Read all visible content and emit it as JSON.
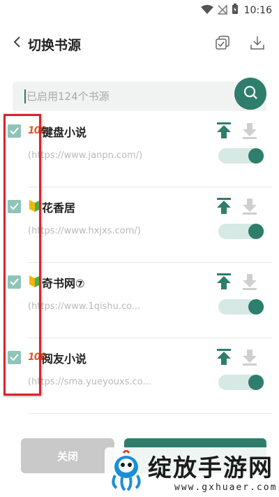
{
  "status_bar": {
    "time": "10:16"
  },
  "header": {
    "title": "切换书源",
    "back_icon": "chevron-left-icon",
    "select_all_icon": "copy-check-icon",
    "download_icon": "download-icon"
  },
  "search": {
    "placeholder": "已启用124个书源",
    "icon": "search-icon"
  },
  "sources": [
    {
      "name": "键盘小说",
      "badge": "100",
      "url": "(https://www.janpn.com/)",
      "checked": true,
      "enabled": true
    },
    {
      "name": "花香居",
      "badge": "shield",
      "url": "(https://www.hxjxs.com/)",
      "checked": true,
      "enabled": true
    },
    {
      "name": "奇书网⑦",
      "badge": "shield",
      "url": "(https://www.1qishu.co...",
      "checked": true,
      "enabled": true
    },
    {
      "name": "阅友小说",
      "badge": "100",
      "url": "(https://sma.yueyouxs.co...",
      "checked": true,
      "enabled": true
    }
  ],
  "footer": {
    "close_label": "关闭"
  },
  "watermark": {
    "text": "绽放手游网",
    "url": "www.gxhuaer.com"
  },
  "colors": {
    "accent": "#2f7d6b",
    "highlight": "#d9232c"
  }
}
